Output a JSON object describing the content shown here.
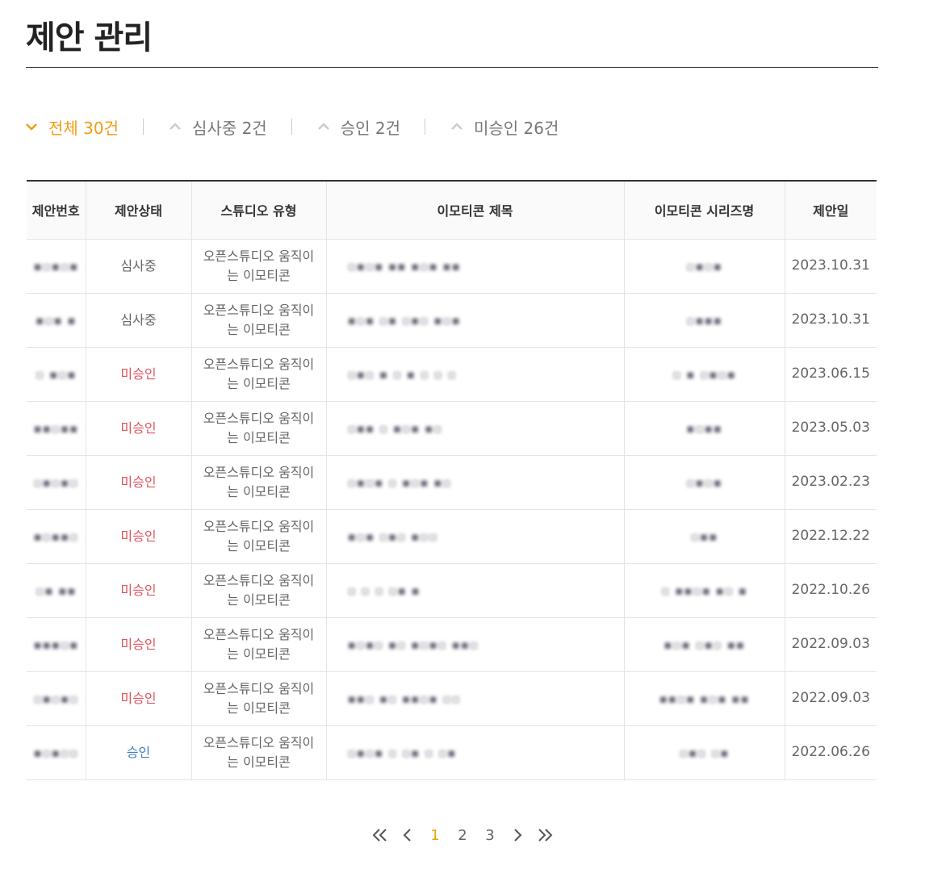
{
  "page": {
    "title": "제안 관리"
  },
  "filters": [
    {
      "label": "전체 30건",
      "active": true
    },
    {
      "label": "심사중 2건",
      "active": false
    },
    {
      "label": "승인 2건",
      "active": false
    },
    {
      "label": "미승인 26건",
      "active": false
    }
  ],
  "table": {
    "headers": [
      "제안번호",
      "제안상태",
      "스튜디오 유형",
      "이모티콘 제목",
      "이모티콘 시리즈명",
      "제안일"
    ],
    "rows": [
      {
        "status": "심사중",
        "status_type": "pending",
        "studio": [
          "오픈스튜디오 움직이",
          "는 이모티콘"
        ],
        "date": "2023.10.31"
      },
      {
        "status": "심사중",
        "status_type": "pending",
        "studio": [
          "오픈스튜디오 움직이",
          "는 이모티콘"
        ],
        "date": "2023.10.31"
      },
      {
        "status": "미승인",
        "status_type": "rejected",
        "studio": [
          "오픈스튜디오 움직이",
          "는 이모티콘"
        ],
        "date": "2023.06.15"
      },
      {
        "status": "미승인",
        "status_type": "rejected",
        "studio": [
          "오픈스튜디오 움직이",
          "는 이모티콘"
        ],
        "date": "2023.05.03"
      },
      {
        "status": "미승인",
        "status_type": "rejected",
        "studio": [
          "오픈스튜디오 움직이",
          "는 이모티콘"
        ],
        "date": "2023.02.23"
      },
      {
        "status": "미승인",
        "status_type": "rejected",
        "studio": [
          "오픈스튜디오 움직이",
          "는 이모티콘"
        ],
        "date": "2022.12.22"
      },
      {
        "status": "미승인",
        "status_type": "rejected",
        "studio": [
          "오픈스튜디오 움직이",
          "는 이모티콘"
        ],
        "date": "2022.10.26"
      },
      {
        "status": "미승인",
        "status_type": "rejected",
        "studio": [
          "오픈스튜디오 움직이",
          "는 이모티콘"
        ],
        "date": "2022.09.03"
      },
      {
        "status": "미승인",
        "status_type": "rejected",
        "studio": [
          "오픈스튜디오 움직이",
          "는 이모티콘"
        ],
        "date": "2022.09.03"
      },
      {
        "status": "승인",
        "status_type": "approved",
        "studio": [
          "오픈스튜디오 움직이",
          "는 이모티콘"
        ],
        "date": "2022.06.26"
      }
    ]
  },
  "pagination": {
    "pages": [
      "1",
      "2",
      "3"
    ],
    "current": "1"
  },
  "colors": {
    "accent": "#f39c12",
    "rejected": "#e0525c",
    "approved": "#3b7cc4"
  }
}
